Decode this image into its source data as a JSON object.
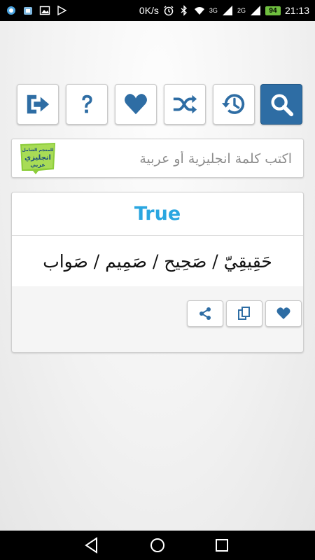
{
  "status_bar": {
    "speed": "0K/s",
    "network_3g": "3G",
    "network_2g": "2G",
    "battery": "94",
    "time": "21:13"
  },
  "toolbar": {
    "buttons": [
      {
        "name": "exit",
        "icon": "exit-icon"
      },
      {
        "name": "help",
        "icon": "question-icon"
      },
      {
        "name": "favorites",
        "icon": "heart-icon"
      },
      {
        "name": "random",
        "icon": "shuffle-icon"
      },
      {
        "name": "history",
        "icon": "history-icon"
      },
      {
        "name": "search",
        "icon": "search-icon",
        "active": true
      }
    ]
  },
  "search": {
    "placeholder": "اكتب كلمة انجليزية أو عربية",
    "logo_text": [
      "للمعجم الشامل",
      "انجليزي",
      "عربي"
    ]
  },
  "result": {
    "word": "True",
    "translation": "حَقِيقِيّ / صَحِيح / صَمِيم / صَواب",
    "actions": [
      {
        "name": "share",
        "icon": "share-icon"
      },
      {
        "name": "copy",
        "icon": "copy-icon"
      },
      {
        "name": "favorite",
        "icon": "heart-icon"
      }
    ]
  },
  "colors": {
    "accent": "#2e6da4",
    "word_color": "#2aa6e0"
  }
}
